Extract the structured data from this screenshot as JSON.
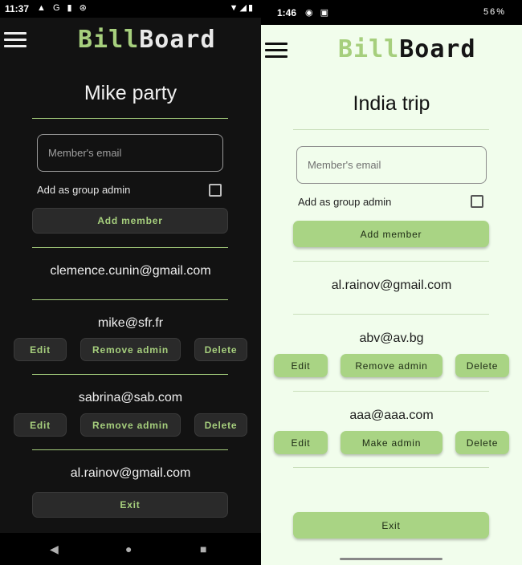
{
  "dark": {
    "status": {
      "time": "11:37",
      "icons": "▲ G ▮ ⊛",
      "right": "▼◢▮"
    },
    "logo": {
      "first": "Bill",
      "second": "Board"
    },
    "title": "Mike party",
    "email_placeholder": "Member's email",
    "admin_label": "Add as group admin",
    "add_member": "Add member",
    "members": [
      {
        "email": "clemence.cunin@gmail.com"
      },
      {
        "email": "mike@sfr.fr",
        "edit": "Edit",
        "admin_action": "Remove admin",
        "delete": "Delete"
      },
      {
        "email": "sabrina@sab.com",
        "edit": "Edit",
        "admin_action": "Remove admin",
        "delete": "Delete"
      },
      {
        "email": "al.rainov@gmail.com"
      }
    ],
    "exit": "Exit"
  },
  "light": {
    "status": {
      "time": "1:46",
      "icons": "◉ ▣",
      "right": "56%"
    },
    "logo": {
      "first": "Bill",
      "second": "Board"
    },
    "title": "India trip",
    "email_placeholder": "Member's email",
    "admin_label": "Add as group admin",
    "add_member": "Add member",
    "members": [
      {
        "email": "al.rainov@gmail.com"
      },
      {
        "email": "abv@av.bg",
        "edit": "Edit",
        "admin_action": "Remove admin",
        "delete": "Delete"
      },
      {
        "email": "aaa@aaa.com",
        "edit": "Edit",
        "admin_action": "Make admin",
        "delete": "Delete"
      }
    ],
    "exit": "Exit"
  },
  "colors": {
    "accent": "#a6cf7d",
    "dark_bg": "#121212",
    "light_bg": "#f1fdec"
  },
  "icons": [
    "menu-icon",
    "back-icon",
    "home-icon",
    "recents-icon"
  ]
}
